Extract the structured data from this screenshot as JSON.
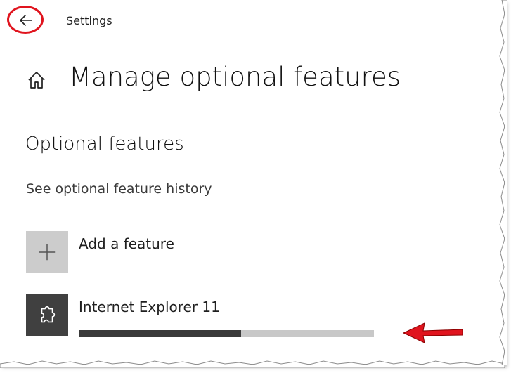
{
  "window": {
    "app_title": "Settings"
  },
  "page": {
    "title": "Manage optional features"
  },
  "section": {
    "title": "Optional features",
    "history_link": "See optional feature history"
  },
  "features": [
    {
      "label": "Add a feature",
      "icon": "plus-icon"
    },
    {
      "label": "Internet Explorer 11",
      "icon": "puzzle-icon",
      "install_progress_percent": 55
    }
  ],
  "colors": {
    "annotation_red": "#e0141e",
    "progress_fill": "#3a3a3a",
    "progress_track": "#c8c8c8",
    "add_tile": "#cccccc",
    "feature_tile": "#404040"
  }
}
